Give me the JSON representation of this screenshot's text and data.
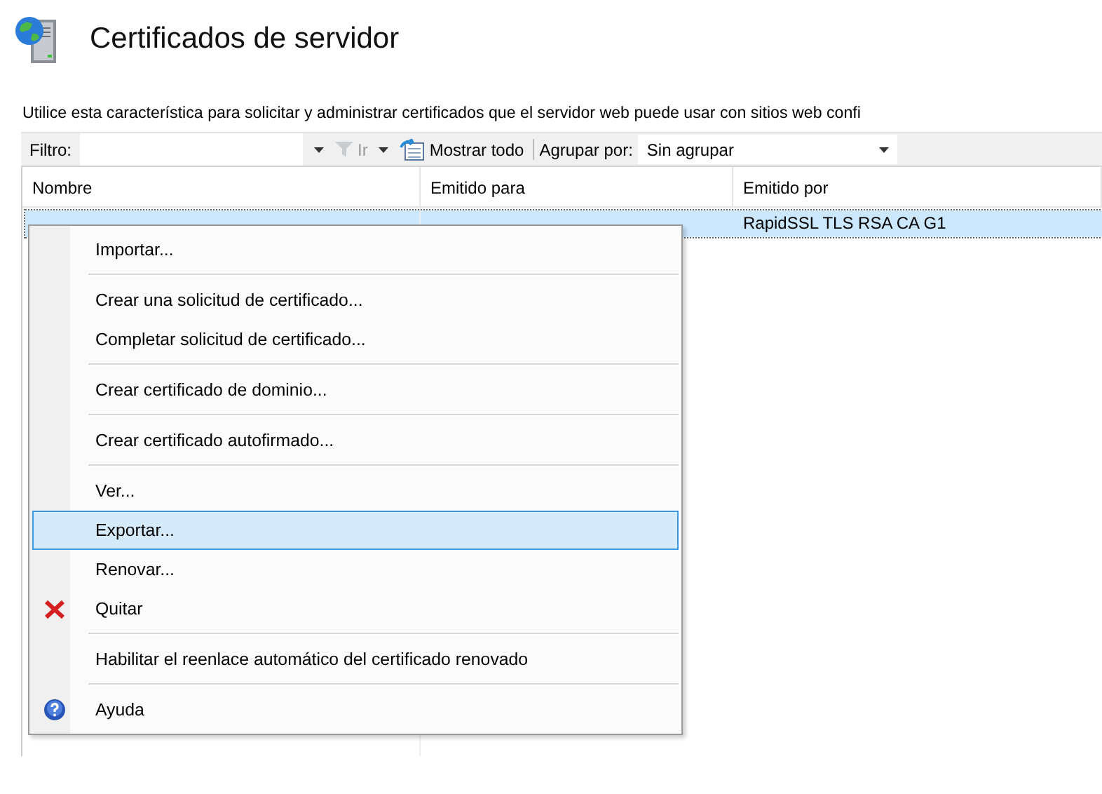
{
  "header": {
    "title": "Certificados de servidor",
    "description": "Utilice esta característica para solicitar y administrar certificados que el servidor web puede usar con sitios web confi"
  },
  "toolbar": {
    "filter_label": "Filtro:",
    "go_button": {
      "label": "Ir",
      "disabled": true
    },
    "show_all_button": {
      "label": "Mostrar todo",
      "disabled": false
    },
    "group_label": "Agrupar por:",
    "group_value": "Sin agrupar"
  },
  "table": {
    "columns": [
      "Nombre",
      "Emitido para",
      "Emitido por"
    ],
    "rows": [
      {
        "selected": true,
        "issued_by": "RapidSSL TLS RSA CA G1"
      }
    ]
  },
  "context_menu": {
    "groups": [
      [
        {
          "label": "Importar...",
          "kind": "plain",
          "selected": false
        }
      ],
      [
        {
          "label": "Crear una solicitud de certificado...",
          "kind": "plain",
          "selected": false
        },
        {
          "label": "Completar solicitud de certificado...",
          "kind": "plain",
          "selected": false
        }
      ],
      [
        {
          "label": "Crear certificado de dominio...",
          "kind": "plain",
          "selected": false
        }
      ],
      [
        {
          "label": "Crear certificado autofirmado...",
          "kind": "plain",
          "selected": false
        }
      ],
      [
        {
          "label": "Ver...",
          "kind": "plain",
          "selected": false
        },
        {
          "label": "Exportar...",
          "kind": "plain",
          "selected": true
        },
        {
          "label": "Renovar...",
          "kind": "plain",
          "selected": false
        },
        {
          "label": "Quitar",
          "kind": "remove",
          "selected": false
        }
      ],
      [
        {
          "label": "Habilitar el reenlace automático del certificado renovado",
          "kind": "plain",
          "selected": false
        }
      ],
      [
        {
          "label": "Ayuda",
          "kind": "help",
          "selected": false
        }
      ]
    ]
  }
}
